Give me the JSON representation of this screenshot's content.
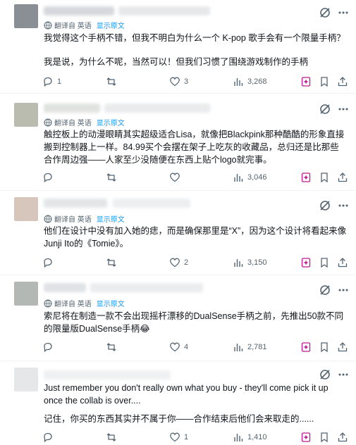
{
  "translate": {
    "label": "翻译自 英语",
    "show_original": "显示原文"
  },
  "posts": [
    {
      "body": [
        "我觉得这个手柄不错，但我不明白为什么一个 K-pop 歌手会有一个限量手柄？",
        "我是说，为什么不呢，当然可以！但我们习惯了围绕游戏制作的手柄"
      ],
      "replies": "1",
      "retweets": "",
      "likes": "3",
      "views": "3,268"
    },
    {
      "body": [
        "触控板上的动漫眼睛其实超级适合Lisa，就像把Blackpink那种酷酷的形象直接搬到控制器上一样。84.99买个会摆在架子上吃灰的收藏品，总归还是比那些合作周边强——人家至少没随便在东西上贴个logo就完事。"
      ],
      "replies": "",
      "retweets": "",
      "likes": "",
      "views": "3,046"
    },
    {
      "body": [
        "他们在设计中没有加入她的痣，而是确保那里是“X”，因为这个设计将看起来像Junji Ito的《Tomie》。"
      ],
      "replies": "",
      "retweets": "",
      "likes": "2",
      "views": "3,150"
    },
    {
      "body": [
        "索尼将在制造一款不会出现摇杆漂移的DualSense手柄之前，先推出50款不同的限量版DualSense手柄😂"
      ],
      "replies": "",
      "retweets": "",
      "likes": "4",
      "views": "2,781"
    },
    {
      "body": [
        "Just remember you don't really own what you buy - they'll come pick it up once the collab is over....",
        "记住，你买的东西其实并不属于你——合作结束后他们会来取走的......"
      ],
      "replies": "",
      "retweets": "",
      "likes": "1",
      "views": "1,410"
    }
  ]
}
